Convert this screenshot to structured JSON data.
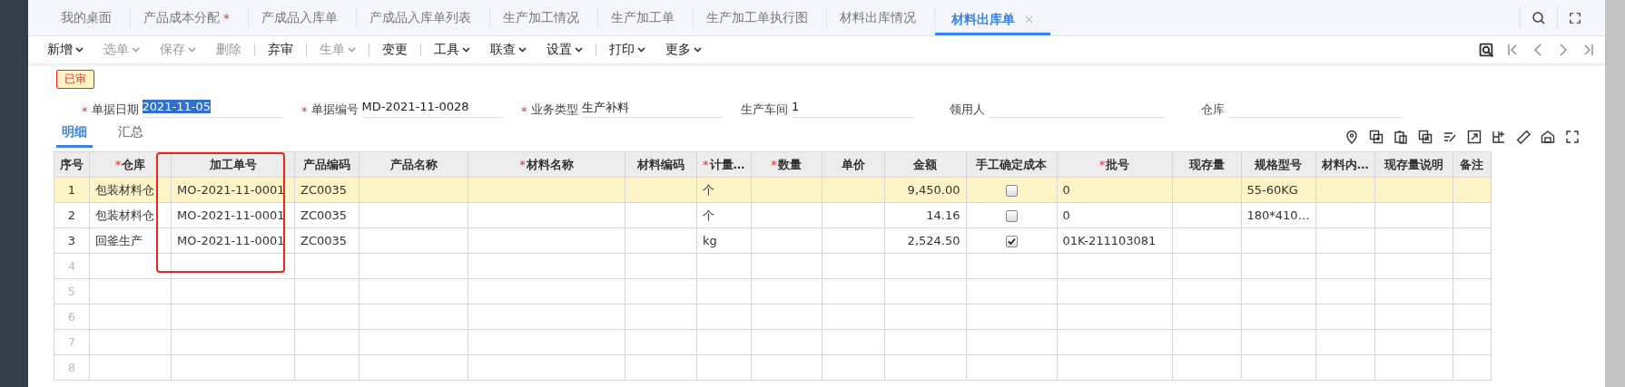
{
  "tabs": [
    {
      "label": "我的桌面",
      "selected": false
    },
    {
      "label": "产品成本分配",
      "modified_mark": "*",
      "selected": false
    },
    {
      "label": "产成品入库单",
      "selected": false
    },
    {
      "label": "产成品入库单列表",
      "selected": false
    },
    {
      "label": "生产加工情况",
      "selected": false
    },
    {
      "label": "生产加工单",
      "selected": false
    },
    {
      "label": "生产加工单执行图",
      "selected": false
    },
    {
      "label": "材料出库情况",
      "selected": false
    },
    {
      "label": "材料出库单",
      "selected": true
    }
  ],
  "toolbar": [
    {
      "kind": "button",
      "label": "新增",
      "dropdown": true,
      "disabled": false
    },
    {
      "kind": "button",
      "label": "选单",
      "dropdown": true,
      "disabled": true
    },
    {
      "kind": "button",
      "label": "保存",
      "dropdown": true,
      "disabled": true
    },
    {
      "kind": "button",
      "label": "删除",
      "dropdown": false,
      "disabled": true
    },
    {
      "kind": "separator"
    },
    {
      "kind": "button",
      "label": "弃审",
      "dropdown": false,
      "disabled": false
    },
    {
      "kind": "separator"
    },
    {
      "kind": "button",
      "label": "生单",
      "dropdown": true,
      "disabled": true
    },
    {
      "kind": "separator"
    },
    {
      "kind": "button",
      "label": "变更",
      "dropdown": false,
      "disabled": false
    },
    {
      "kind": "separator"
    },
    {
      "kind": "button",
      "label": "工具",
      "dropdown": true,
      "disabled": false
    },
    {
      "kind": "button",
      "label": "联查",
      "dropdown": true,
      "disabled": false
    },
    {
      "kind": "button",
      "label": "设置",
      "dropdown": true,
      "disabled": false
    },
    {
      "kind": "separator"
    },
    {
      "kind": "button",
      "label": "打印",
      "dropdown": true,
      "disabled": false
    },
    {
      "kind": "button",
      "label": "更多",
      "dropdown": true,
      "disabled": false
    }
  ],
  "status_badge": "已审",
  "form_fields": [
    {
      "label": "单据日期",
      "required_mark": "*",
      "value": "2021-11-05",
      "value_selected": true
    },
    {
      "label": "单据编号",
      "required_mark": "*",
      "value": "MD-2021-11-0028",
      "value_selected": false
    },
    {
      "label": "业务类型",
      "required_mark": "*",
      "value": "生产补料",
      "value_selected": false
    },
    {
      "label": "生产车间",
      "value": "1",
      "value_selected": false
    },
    {
      "label": "领用人"
    },
    {
      "label": "仓库"
    }
  ],
  "detail_tabs": [
    {
      "label": "明细",
      "selected": true
    },
    {
      "label": "汇总",
      "selected": false
    }
  ],
  "table": {
    "columns": [
      {
        "label": "序号",
        "kind": "index",
        "highlighted": false
      },
      {
        "label": "仓库",
        "required_mark": "*",
        "kind": "text",
        "highlighted": false
      },
      {
        "label": "加工单号",
        "kind": "text",
        "highlighted": true
      },
      {
        "label": "产品编码",
        "kind": "text",
        "highlighted": false
      },
      {
        "label": "产品名称",
        "kind": "text",
        "highlighted": false
      },
      {
        "label": "材料名称",
        "required_mark": "*",
        "kind": "text",
        "highlighted": false
      },
      {
        "label": "材料编码",
        "kind": "text",
        "highlighted": false
      },
      {
        "label": "计量…",
        "required_mark": "*",
        "kind": "text",
        "highlighted": false
      },
      {
        "label": "数量",
        "required_mark": "*",
        "kind": "number",
        "highlighted": false
      },
      {
        "label": "单价",
        "kind": "number",
        "highlighted": false
      },
      {
        "label": "金额",
        "kind": "number",
        "highlighted": false
      },
      {
        "label": "手工确定成本",
        "kind": "check",
        "highlighted": false
      },
      {
        "label": "批号",
        "required_mark": "*",
        "kind": "text",
        "highlighted": false
      },
      {
        "label": "现存量",
        "kind": "number",
        "highlighted": false
      },
      {
        "label": "规格型号",
        "kind": "text",
        "highlighted": false
      },
      {
        "label": "材料内…",
        "kind": "text",
        "highlighted": false
      },
      {
        "label": "现存量说明",
        "kind": "text",
        "highlighted": false
      },
      {
        "label": "备注",
        "kind": "text",
        "highlighted": false
      }
    ],
    "rows": [
      {
        "selected": true,
        "cells": [
          "1",
          "包装材料仓",
          "MO-2021-11-0001",
          "ZC0035",
          null,
          null,
          null,
          "个",
          null,
          null,
          "9,450.00",
          {
            "checked": false
          },
          "0",
          null,
          "55-60KG",
          null,
          null,
          null
        ]
      },
      {
        "selected": false,
        "cells": [
          "2",
          "包装材料仓",
          "MO-2021-11-0001",
          "ZC0035",
          null,
          null,
          null,
          "个",
          null,
          null,
          "14.16",
          {
            "checked": false
          },
          "0",
          null,
          "180*410…",
          null,
          null,
          null
        ]
      },
      {
        "selected": false,
        "cells": [
          "3",
          "回釜生产",
          "MO-2021-11-0001",
          "ZC0035",
          null,
          null,
          null,
          "kg",
          null,
          null,
          "2,524.50",
          {
            "checked": true
          },
          "01K-211103081",
          null,
          null,
          null,
          null,
          null
        ]
      },
      {
        "selected": false,
        "cells": [
          "4"
        ]
      },
      {
        "selected": false,
        "cells": [
          "5"
        ]
      },
      {
        "selected": false,
        "cells": [
          "6"
        ]
      },
      {
        "selected": false,
        "cells": [
          "7"
        ]
      },
      {
        "selected": false,
        "cells": [
          "8"
        ]
      }
    ]
  }
}
